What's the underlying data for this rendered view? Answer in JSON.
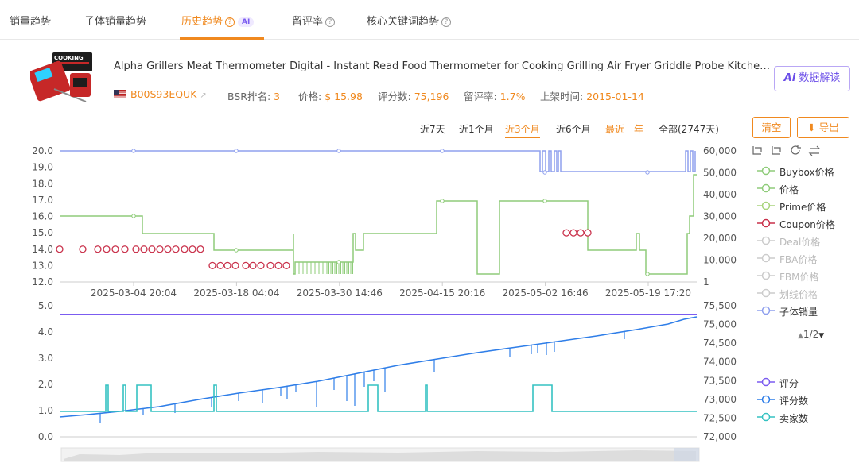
{
  "tabs": [
    {
      "label": "销量趋势"
    },
    {
      "label": "子体销量趋势"
    },
    {
      "label": "历史趋势",
      "ai": "AI"
    },
    {
      "label": "留评率"
    },
    {
      "label": "核心关键词趋势"
    }
  ],
  "product": {
    "title": "Alpha Grillers Meat Thermometer Digital - Instant Read Food Thermometer for Cooking Grilling Air Fryer Griddle Probe Kitchen Gad...",
    "asin": "B00S93EQUK",
    "bsr_label": "BSR排名:",
    "bsr": "3",
    "price_label": "价格:",
    "price": "$ 15.98",
    "reviews_label": "评分数:",
    "reviews": "75,196",
    "rate_label": "留评率:",
    "rate": "1.7%",
    "listed_label": "上架时间:",
    "listed": "2015-01-14",
    "image_text": "COOKING"
  },
  "ai_button": {
    "ai": "Ai",
    "label": "数据解读"
  },
  "ranges": [
    "近7天",
    "近1个月",
    "近3个月",
    "近6个月",
    "最近一年",
    "全部(2747天)"
  ],
  "buttons": {
    "clear": "清空",
    "export": "导出"
  },
  "legend_top": [
    {
      "label": "Buybox价格",
      "color": "#8fcc7a",
      "dim": false
    },
    {
      "label": "价格",
      "color": "#8fcc7a",
      "dim": false
    },
    {
      "label": "Prime价格",
      "color": "#a8d47c",
      "dim": false
    },
    {
      "label": "Coupon价格",
      "color": "#c9304a",
      "dim": false
    },
    {
      "label": "Deal价格",
      "color": "#cccccc",
      "dim": true
    },
    {
      "label": "FBA价格",
      "color": "#cccccc",
      "dim": true
    },
    {
      "label": "FBM价格",
      "color": "#cccccc",
      "dim": true
    },
    {
      "label": "划线价格",
      "color": "#cccccc",
      "dim": true
    },
    {
      "label": "子体销量",
      "color": "#8fa0ee",
      "dim": false
    }
  ],
  "legend_bottom": [
    {
      "label": "评分",
      "color": "#7b5cf0"
    },
    {
      "label": "评分数",
      "color": "#2f7ee8"
    },
    {
      "label": "卖家数",
      "color": "#35c2c2"
    }
  ],
  "pager": "1/2",
  "chart_data": [
    {
      "type": "line",
      "x_ticks": [
        "2025-03-04 20:04",
        "2025-03-18 04:04",
        "2025-03-30 14:46",
        "2025-04-15 20:16",
        "2025-05-02 16:46",
        "2025-05-19 17:20"
      ],
      "ylim": [
        12.0,
        20.0
      ],
      "y_ticks": [
        "20.0",
        "19.0",
        "18.0",
        "17.0",
        "16.0",
        "15.0",
        "14.0",
        "13.0",
        "12.0"
      ],
      "y2lim": [
        1,
        60000
      ],
      "y2_ticks": [
        "60,000",
        "50,000",
        "40,000",
        "30,000",
        "20,000",
        "10,000",
        "1"
      ],
      "x_days": [
        0,
        7.5,
        14,
        21,
        22.5,
        24,
        27,
        34,
        35,
        37,
        38,
        42,
        43,
        46,
        47,
        49,
        51,
        54,
        58,
        67,
        74,
        75,
        81,
        84,
        88.5,
        90,
        91
      ],
      "series": [
        {
          "name": "价格",
          "color": "#8fcc7a",
          "points": [
            [
              0,
              16
            ],
            [
              7.5,
              16
            ],
            [
              7.5,
              15
            ],
            [
              14,
              15
            ],
            [
              14,
              14
            ],
            [
              21,
              14
            ],
            [
              21,
              12.5
            ],
            [
              24,
              12.5
            ],
            [
              24,
              12.5
            ],
            [
              27,
              12.5
            ],
            [
              27,
              14
            ],
            [
              27.5,
              14
            ],
            [
              27.5,
              15
            ],
            [
              34,
              15
            ],
            [
              34,
              17
            ],
            [
              37,
              17
            ],
            [
              37,
              12.5
            ],
            [
              38.5,
              12.5
            ],
            [
              38.5,
              17
            ],
            [
              46,
              17
            ],
            [
              46,
              14
            ],
            [
              50,
              14
            ],
            [
              50,
              14
            ],
            [
              50,
              15
            ],
            [
              51,
              15
            ],
            [
              51,
              14
            ],
            [
              54,
              14
            ],
            [
              54,
              14
            ],
            [
              58,
              14
            ],
            [
              58,
              13
            ],
            [
              58,
              12.5
            ],
            [
              58,
              12.5
            ],
            [
              58,
              12.5
            ],
            [
              90,
              12.5
            ]
          ],
          "points_note": "step line"
        },
        {
          "name": "Coupon价格",
          "color": "#c9304a",
          "points": [
            [
              0,
              14
            ],
            [
              2,
              14
            ],
            [
              3,
              14
            ],
            [
              4,
              14
            ],
            [
              5,
              14
            ],
            [
              6,
              14
            ],
            [
              7,
              14
            ],
            [
              8,
              14
            ],
            [
              9,
              14
            ],
            [
              10,
              14
            ],
            [
              11,
              14
            ],
            [
              12,
              14
            ],
            [
              13,
              14
            ],
            [
              14,
              14
            ],
            [
              15,
              14
            ],
            [
              16,
              14
            ],
            [
              10.5,
              13
            ],
            [
              11.5,
              13
            ],
            [
              12.5,
              13
            ],
            [
              13.5,
              13
            ],
            [
              14.5,
              13
            ],
            [
              15.5,
              13
            ],
            [
              16.5,
              13
            ],
            [
              17.5,
              13
            ],
            [
              18.5,
              13
            ],
            [
              19.5,
              13
            ],
            [
              20.5,
              13
            ],
            [
              21.5,
              13
            ],
            [
              42,
              15
            ],
            [
              43,
              15
            ],
            [
              44,
              15
            ],
            [
              45,
              15
            ]
          ]
        },
        {
          "name": "子体销量",
          "color": "#8fa0ee",
          "points": [
            [
              0,
              60000
            ],
            [
              70,
              60000
            ],
            [
              70,
              50000
            ],
            [
              90,
              50000
            ]
          ]
        }
      ],
      "grid": false
    },
    {
      "type": "line",
      "ylim": [
        0.0,
        5.0
      ],
      "y_ticks": [
        "5.0",
        "4.0",
        "3.0",
        "2.0",
        "1.0",
        "0.0"
      ],
      "y2lim": [
        72000,
        75500
      ],
      "y2_ticks": [
        "75,500",
        "75,000",
        "74,500",
        "74,000",
        "73,500",
        "73,000",
        "72,500",
        "72,000"
      ],
      "series": [
        {
          "name": "评分",
          "color": "#7b5cf0",
          "values_const": 4.7
        },
        {
          "name": "评分数",
          "color": "#2f7ee8",
          "start": 72520,
          "end": 75190
        },
        {
          "name": "卖家数",
          "color": "#35c2c2",
          "base": 1,
          "spikes_to": 2
        }
      ],
      "grid": false
    }
  ]
}
